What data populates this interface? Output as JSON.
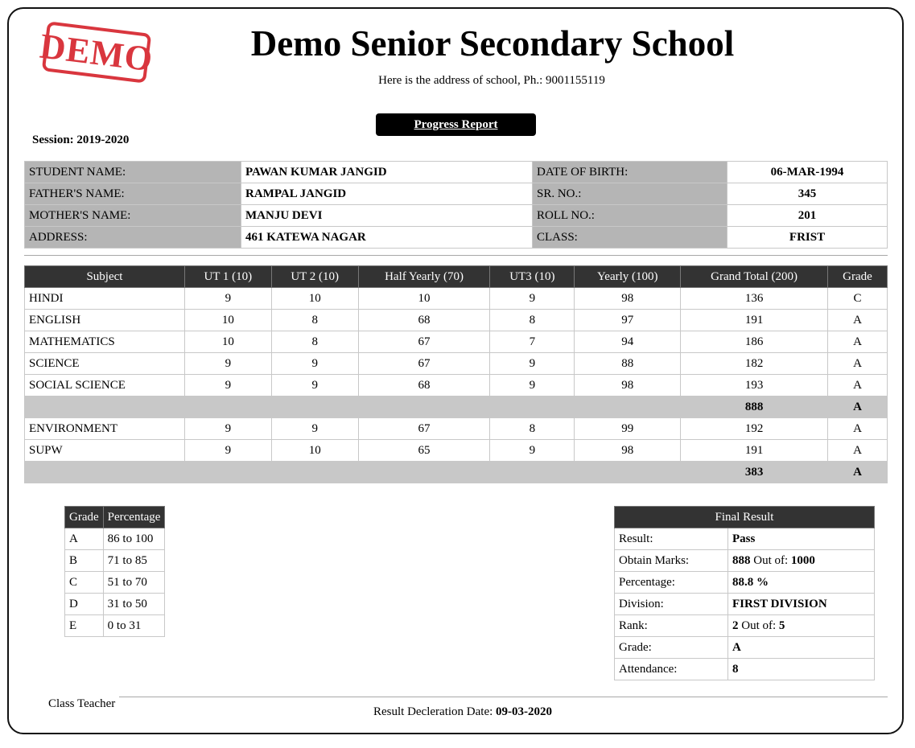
{
  "stamp": "DEMO",
  "school": {
    "name": "Demo Senior Secondary School",
    "address": "Here is the address of school, Ph.: 9001155119"
  },
  "report_title": "Progress Report",
  "session": "Session: 2019-2020",
  "student": {
    "name_label": "STUDENT NAME:",
    "name": "PAWAN KUMAR JANGID",
    "father_label": "FATHER'S NAME:",
    "father": "RAMPAL JANGID",
    "mother_label": "MOTHER'S NAME:",
    "mother": "MANJU DEVI",
    "address_label": "ADDRESS:",
    "address": "461 KATEWA NAGAR",
    "dob_label": "DATE OF BIRTH:",
    "dob": "06-MAR-1994",
    "sr_label": "SR. NO.:",
    "sr": "345",
    "roll_label": "ROLL NO.:",
    "roll": "201",
    "class_label": "CLASS:",
    "class": "FRIST"
  },
  "marks": {
    "headers": [
      "Subject",
      "UT 1 (10)",
      "UT 2 (10)",
      "Half Yearly (70)",
      "UT3 (10)",
      "Yearly (100)",
      "Grand Total (200)",
      "Grade"
    ],
    "group1": [
      [
        "HINDI",
        "9",
        "10",
        "10",
        "9",
        "98",
        "136",
        "C"
      ],
      [
        "ENGLISH",
        "10",
        "8",
        "68",
        "8",
        "97",
        "191",
        "A"
      ],
      [
        "MATHEMATICS",
        "10",
        "8",
        "67",
        "7",
        "94",
        "186",
        "A"
      ],
      [
        "SCIENCE",
        "9",
        "9",
        "67",
        "9",
        "88",
        "182",
        "A"
      ],
      [
        "SOCIAL SCIENCE",
        "9",
        "9",
        "68",
        "9",
        "98",
        "193",
        "A"
      ]
    ],
    "group1_total": "888",
    "group1_grade": "A",
    "group2": [
      [
        "ENVIRONMENT",
        "9",
        "9",
        "67",
        "8",
        "99",
        "192",
        "A"
      ],
      [
        "SUPW",
        "9",
        "10",
        "65",
        "9",
        "98",
        "191",
        "A"
      ]
    ],
    "group2_total": "383",
    "group2_grade": "A"
  },
  "grade_scale": {
    "headers": [
      "Grade",
      "Percentage"
    ],
    "rows": [
      [
        "A",
        "86 to 100"
      ],
      [
        "B",
        "71 to 85"
      ],
      [
        "C",
        "51 to 70"
      ],
      [
        "D",
        "31 to 50"
      ],
      [
        "E",
        "0 to 31"
      ]
    ]
  },
  "final_result": {
    "title": "Final Result",
    "result_label": "Result:",
    "result": "Pass",
    "obtain_label": "Obtain Marks:",
    "obtain": "888",
    "out_of_label": "Out of:",
    "obtain_total": "1000",
    "percentage_label": "Percentage:",
    "percentage": "88.8 %",
    "division_label": "Division:",
    "division": "FIRST DIVISION",
    "rank_label": "Rank:",
    "rank": "2",
    "rank_out_of_label": "Out of:",
    "rank_total": "5",
    "grade_label": "Grade:",
    "grade": "A",
    "attendance_label": "Attendance:",
    "attendance": "8"
  },
  "footer": {
    "teacher": "Class Teacher",
    "declaration_label": "Result Decleration Date:",
    "declaration_date": "09-03-2020"
  }
}
